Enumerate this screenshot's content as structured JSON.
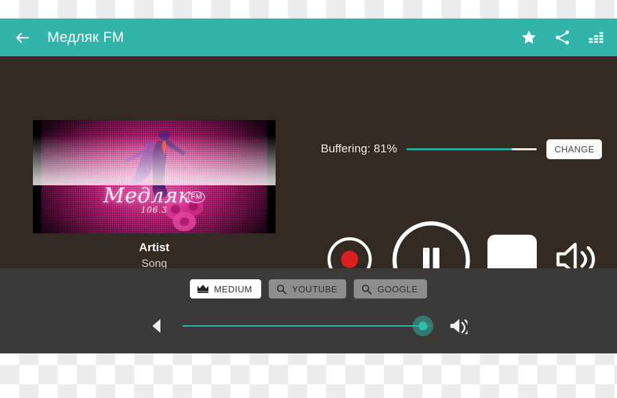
{
  "app": {
    "header": {
      "back_icon": "back-arrow-icon",
      "title": "Медляк FM",
      "actions": [
        {
          "name": "favorite-star-icon",
          "label": "Favorite"
        },
        {
          "name": "share-icon",
          "label": "Share"
        },
        {
          "name": "equalizer-icon",
          "label": "Equalizer"
        }
      ]
    },
    "artwork": {
      "station_wordmark": "Медляк",
      "fm_badge": "FM",
      "frequency": "106.3",
      "alt": "Dancing couple silhouette on pink radial glow"
    },
    "track": {
      "artist": "Artist",
      "song": "Song"
    },
    "buffering": {
      "label": "Buffering: 81%",
      "percent": 81,
      "change_button": "CHANGE"
    },
    "transport": [
      {
        "name": "record-button",
        "label": "Record"
      },
      {
        "name": "pause-button",
        "label": "Pause"
      },
      {
        "name": "stop-button",
        "label": "Stop"
      },
      {
        "name": "volume-button",
        "label": "Volume"
      }
    ],
    "chips": [
      {
        "name": "chip-medium",
        "icon": "crown-icon",
        "label": "MEDIUM",
        "style": "light"
      },
      {
        "name": "chip-youtube",
        "icon": "search-icon",
        "label": "YOUTUBE",
        "style": "dark"
      },
      {
        "name": "chip-google",
        "icon": "search-icon",
        "label": "GOOGLE",
        "style": "dark"
      }
    ],
    "volume": {
      "down_icon": "volume-down-icon",
      "up_icon": "volume-up-icon",
      "percent": 97
    },
    "colors": {
      "appbar": "#32b4aa",
      "stage": "#332a23",
      "lower_panel": "#3c3a39",
      "accent": "#2fbcab",
      "record": "#dc2020"
    }
  }
}
